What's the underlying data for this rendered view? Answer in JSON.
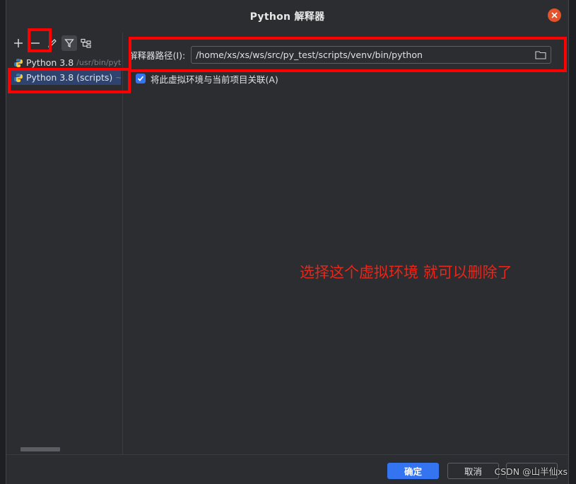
{
  "dialog": {
    "title": "Python 解释器",
    "close_icon": "close-icon"
  },
  "toolbar": {
    "items": [
      {
        "name": "add-icon"
      },
      {
        "name": "remove-icon"
      },
      {
        "name": "edit-icon"
      },
      {
        "name": "filter-icon"
      },
      {
        "name": "tree-icon"
      }
    ]
  },
  "interpreters": [
    {
      "name": "Python 3.8",
      "path": "/usr/bin/pyth",
      "selected": false
    },
    {
      "name": "Python 3.8 (scripts)",
      "path": "~/",
      "selected": true
    }
  ],
  "details": {
    "path_label": "解释器路径(I):",
    "path_value": "/home/xs/xs/ws/src/py_test/scripts/venv/bin/python",
    "checkbox_label": "将此虚拟环境与当前项目关联(A)",
    "checkbox_checked": true
  },
  "annotation": "选择这个虚拟环境 就可以删除了",
  "footer": {
    "ok_label": "确定",
    "cancel_label": "取消"
  },
  "watermark": "CSDN @山半仙xs",
  "colors": {
    "accent": "#3574f0",
    "highlight": "#ff0000",
    "annotation": "#e8261a",
    "close": "#e5532b",
    "selection": "#2e436e"
  }
}
